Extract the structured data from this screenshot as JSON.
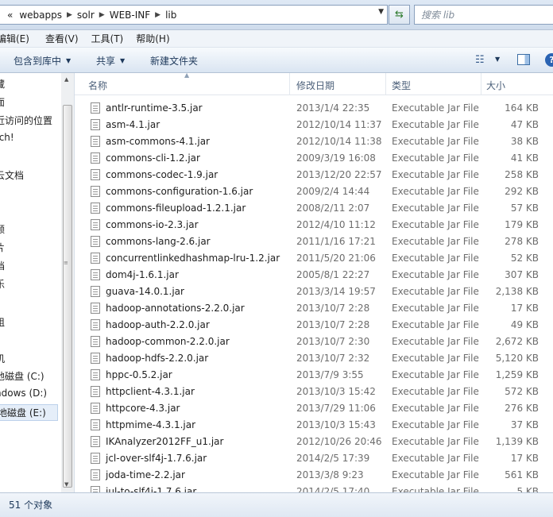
{
  "address": {
    "prefix": "«",
    "crumbs": [
      "webapps",
      "solr",
      "WEB-INF",
      "lib"
    ],
    "search_placeholder": "搜索 lib"
  },
  "menu": [
    "编辑(E)",
    "查看(V)",
    "工具(T)",
    "帮助(H)"
  ],
  "commands": {
    "include_library": "包含到库中",
    "share": "共享",
    "new_folder": "新建文件夹"
  },
  "nav": [
    "藏",
    "面",
    "近访问的位置",
    "tch!",
    "云文档",
    "频",
    "片",
    "档",
    "乐",
    "组",
    "机",
    "地磁盘 (C:)",
    "ndows (D:)",
    "地磁盘 (E:)"
  ],
  "columns": {
    "name": "名称",
    "date": "修改日期",
    "type": "类型",
    "size": "大小"
  },
  "files": [
    {
      "name": "antlr-runtime-3.5.jar",
      "date": "2013/1/4 22:35",
      "type": "Executable Jar File",
      "size": "164 KB"
    },
    {
      "name": "asm-4.1.jar",
      "date": "2012/10/14 11:37",
      "type": "Executable Jar File",
      "size": "47 KB"
    },
    {
      "name": "asm-commons-4.1.jar",
      "date": "2012/10/14 11:38",
      "type": "Executable Jar File",
      "size": "38 KB"
    },
    {
      "name": "commons-cli-1.2.jar",
      "date": "2009/3/19 16:08",
      "type": "Executable Jar File",
      "size": "41 KB"
    },
    {
      "name": "commons-codec-1.9.jar",
      "date": "2013/12/20 22:57",
      "type": "Executable Jar File",
      "size": "258 KB"
    },
    {
      "name": "commons-configuration-1.6.jar",
      "date": "2009/2/4 14:44",
      "type": "Executable Jar File",
      "size": "292 KB"
    },
    {
      "name": "commons-fileupload-1.2.1.jar",
      "date": "2008/2/11 2:07",
      "type": "Executable Jar File",
      "size": "57 KB"
    },
    {
      "name": "commons-io-2.3.jar",
      "date": "2012/4/10 11:12",
      "type": "Executable Jar File",
      "size": "179 KB"
    },
    {
      "name": "commons-lang-2.6.jar",
      "date": "2011/1/16 17:21",
      "type": "Executable Jar File",
      "size": "278 KB"
    },
    {
      "name": "concurrentlinkedhashmap-lru-1.2.jar",
      "date": "2011/5/20 21:06",
      "type": "Executable Jar File",
      "size": "52 KB"
    },
    {
      "name": "dom4j-1.6.1.jar",
      "date": "2005/8/1 22:27",
      "type": "Executable Jar File",
      "size": "307 KB"
    },
    {
      "name": "guava-14.0.1.jar",
      "date": "2013/3/14 19:57",
      "type": "Executable Jar File",
      "size": "2,138 KB"
    },
    {
      "name": "hadoop-annotations-2.2.0.jar",
      "date": "2013/10/7 2:28",
      "type": "Executable Jar File",
      "size": "17 KB"
    },
    {
      "name": "hadoop-auth-2.2.0.jar",
      "date": "2013/10/7 2:28",
      "type": "Executable Jar File",
      "size": "49 KB"
    },
    {
      "name": "hadoop-common-2.2.0.jar",
      "date": "2013/10/7 2:30",
      "type": "Executable Jar File",
      "size": "2,672 KB"
    },
    {
      "name": "hadoop-hdfs-2.2.0.jar",
      "date": "2013/10/7 2:32",
      "type": "Executable Jar File",
      "size": "5,120 KB"
    },
    {
      "name": "hppc-0.5.2.jar",
      "date": "2013/7/9 3:55",
      "type": "Executable Jar File",
      "size": "1,259 KB"
    },
    {
      "name": "httpclient-4.3.1.jar",
      "date": "2013/10/3 15:42",
      "type": "Executable Jar File",
      "size": "572 KB"
    },
    {
      "name": "httpcore-4.3.jar",
      "date": "2013/7/29 11:06",
      "type": "Executable Jar File",
      "size": "276 KB"
    },
    {
      "name": "httpmime-4.3.1.jar",
      "date": "2013/10/3 15:43",
      "type": "Executable Jar File",
      "size": "37 KB"
    },
    {
      "name": "IKAnalyzer2012FF_u1.jar",
      "date": "2012/10/26 20:46",
      "type": "Executable Jar File",
      "size": "1,139 KB"
    },
    {
      "name": "jcl-over-slf4j-1.7.6.jar",
      "date": "2014/2/5 17:39",
      "type": "Executable Jar File",
      "size": "17 KB"
    },
    {
      "name": "joda-time-2.2.jar",
      "date": "2013/3/8 9:23",
      "type": "Executable Jar File",
      "size": "561 KB"
    },
    {
      "name": "jul-to-slf4j-1.7.6.jar",
      "date": "2014/2/5 17:40",
      "type": "Executable Jar File",
      "size": "5 KB"
    }
  ],
  "status": "51 个对象"
}
